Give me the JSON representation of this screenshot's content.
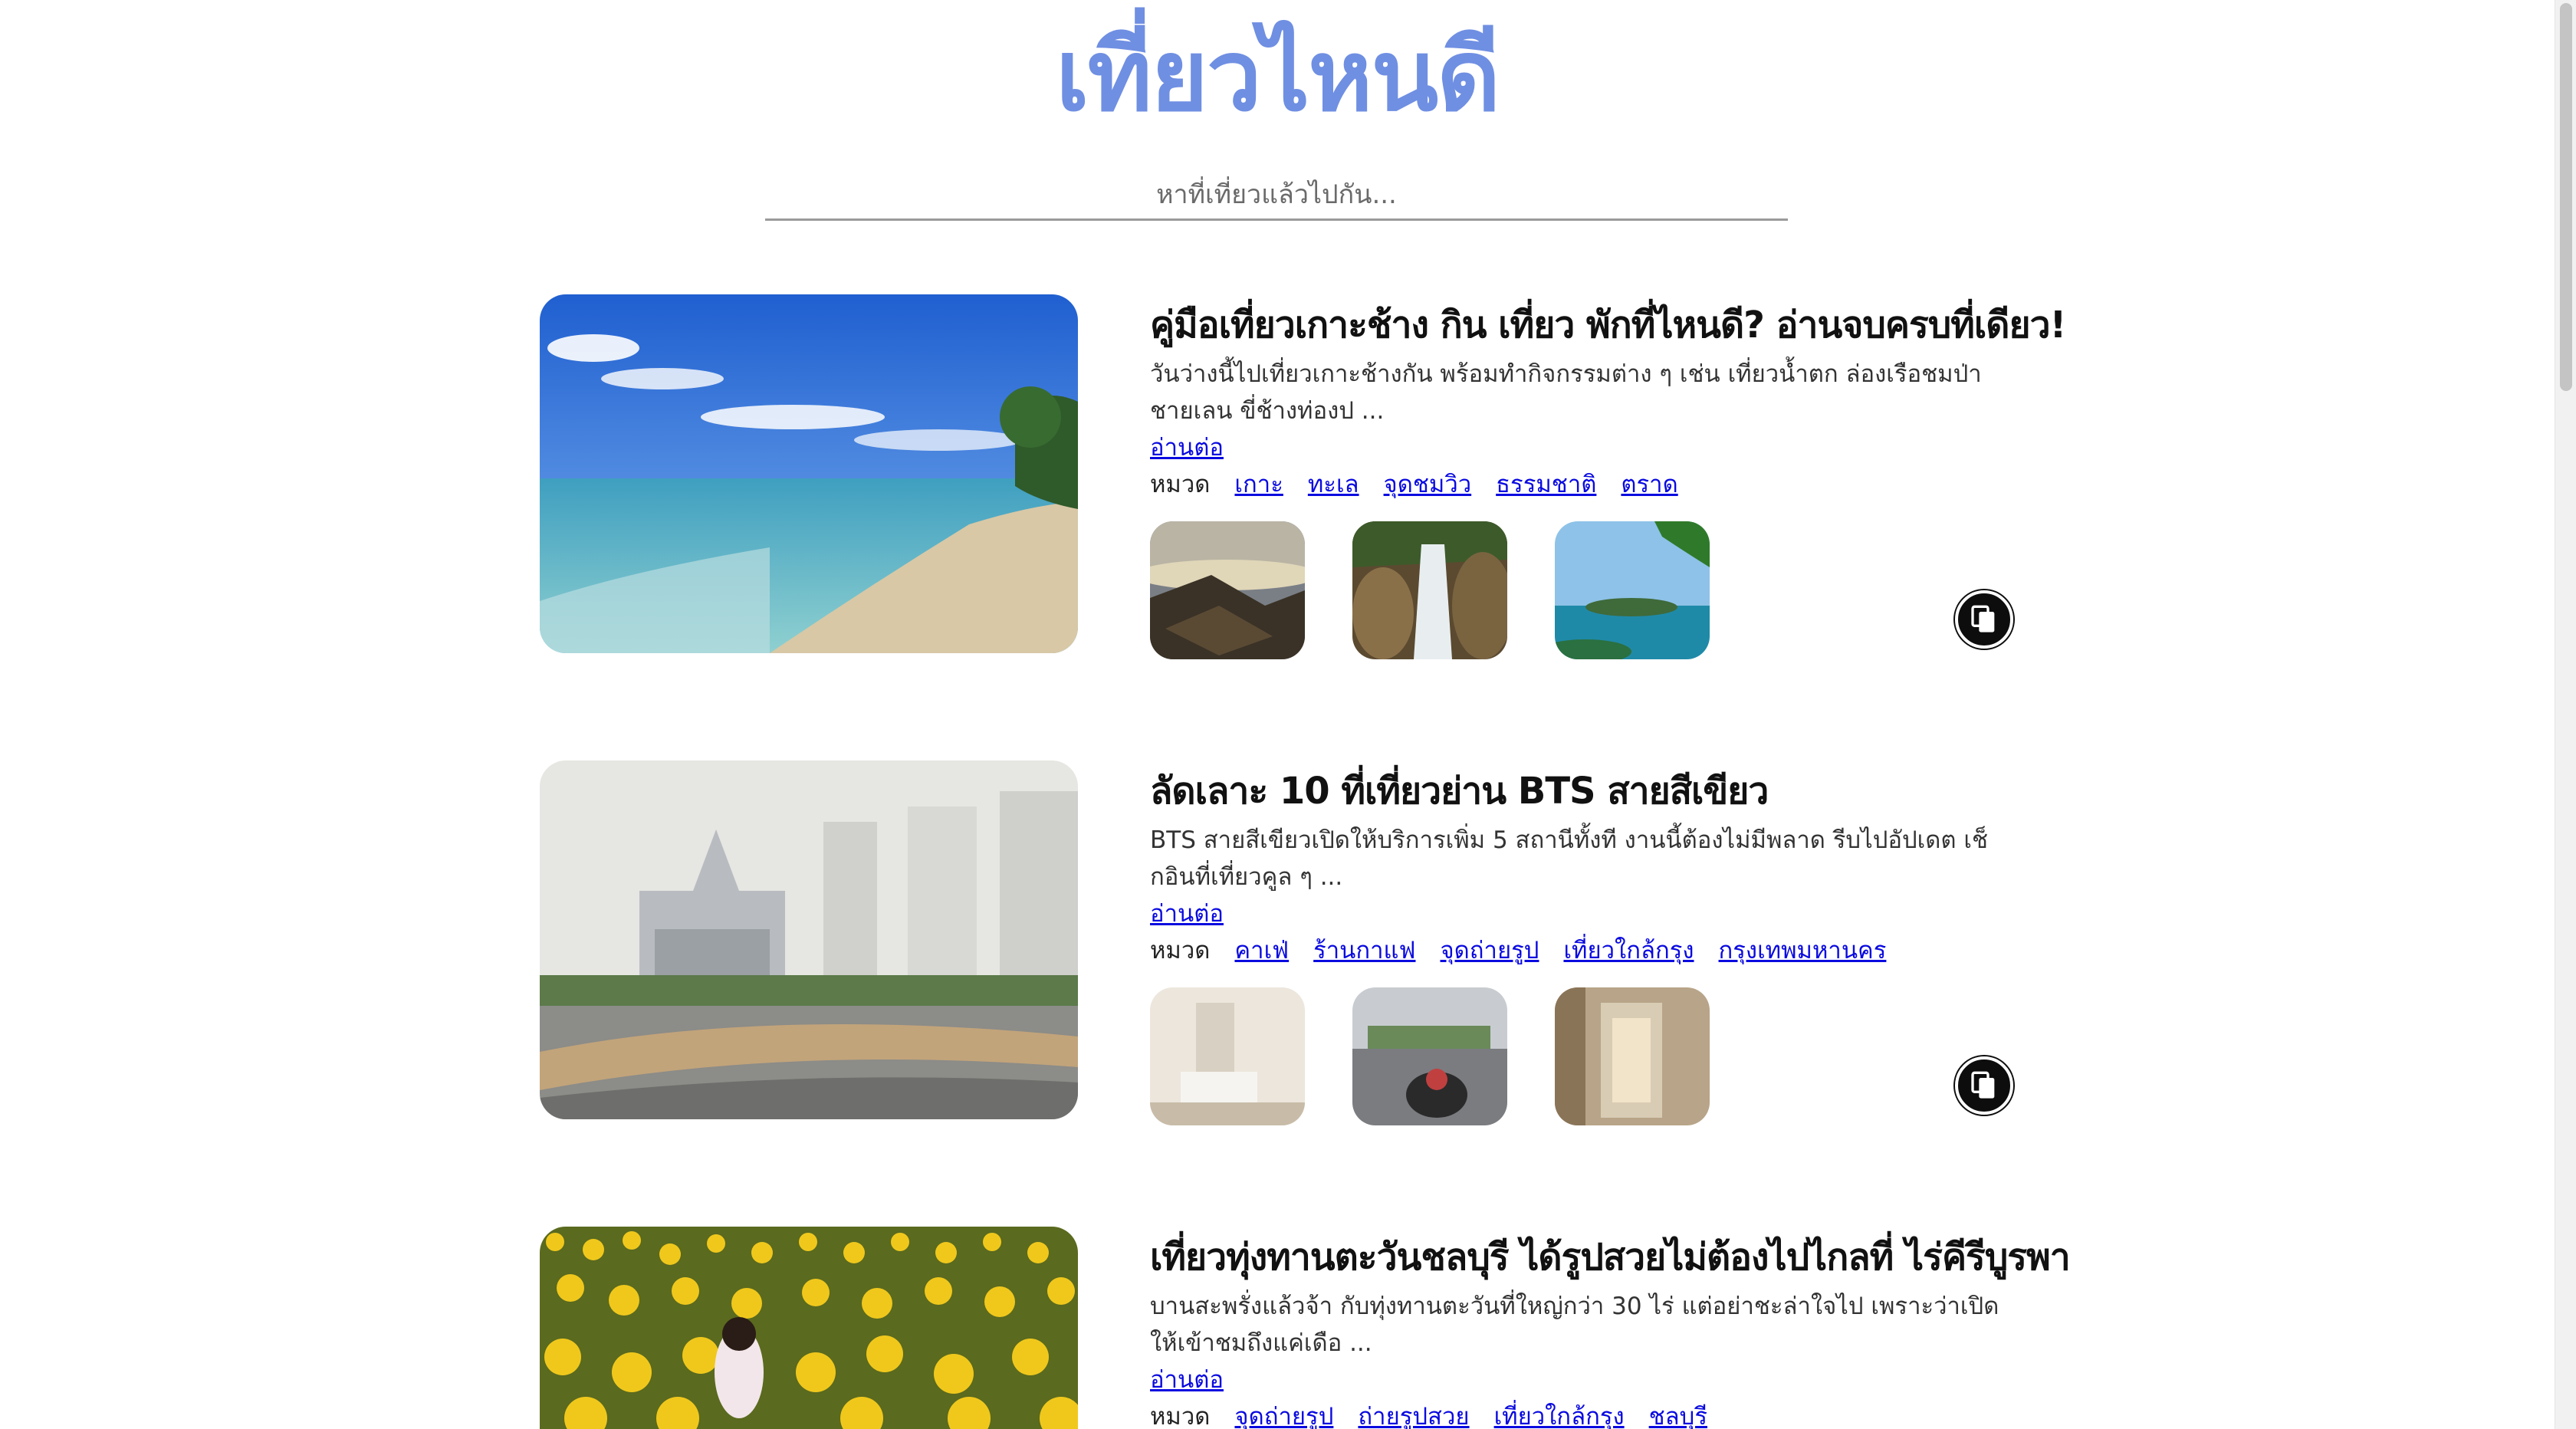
{
  "site": {
    "title": "เที่ยวไหนดี"
  },
  "search": {
    "placeholder": "หาที่เที่ยวแล้วไปกัน..."
  },
  "labels": {
    "category": "หมวด",
    "read_more": "อ่านต่อ"
  },
  "posts": [
    {
      "title": "คู่มือเที่ยวเกาะช้าง กิน เที่ยว พักที่ไหนดี? อ่านจบครบที่เดียว!",
      "description": "วันว่างนี้ไปเที่ยวเกาะช้างกัน พร้อมทำกิจกรรมต่าง ๆ เช่น เที่ยวน้ำตก ล่องเรือชมป่าชายเลน ขี่ช้างท่องป ...",
      "categories": [
        "เกาะ",
        "ทะเล",
        "จุดชมวิว",
        "ธรรมชาติ",
        "ตราด"
      ]
    },
    {
      "title": "ลัดเลาะ 10 ที่เที่ยวย่าน BTS สายสีเขียว",
      "description": "BTS สายสีเขียวเปิดให้บริการเพิ่ม 5 สถานีทั้งที งานนี้ต้องไม่มีพลาด รีบไปอัปเดต เช็กอินที่เที่ยวคูล ๆ ...",
      "categories": [
        "คาเฟ่",
        "ร้านกาแฟ",
        "จุดถ่ายรูป",
        "เที่ยวใกล้กรุง",
        "กรุงเทพมหานคร"
      ]
    },
    {
      "title": "เที่ยวทุ่งทานตะวันชลบุรี ได้รูปสวยไม่ต้องไปไกลที่ ไร่คีรีบูรพา",
      "description": "บานสะพรั่งแล้วจ้า กับทุ่งทานตะวันที่ใหญ่กว่า 30 ไร่ แต่อย่าชะล่าใจไป เพราะว่าเปิดให้เข้าชมถึงแค่เดือ ...",
      "categories": [
        "จุดถ่ายรูป",
        "ถ่ายรูปสวย",
        "เที่ยวใกล้กรุง",
        "ชลบุรี"
      ]
    }
  ],
  "icons": {
    "copy": "copy-icon"
  },
  "colors": {
    "title": "#6f8fe2",
    "link": "#0a0ae0"
  }
}
